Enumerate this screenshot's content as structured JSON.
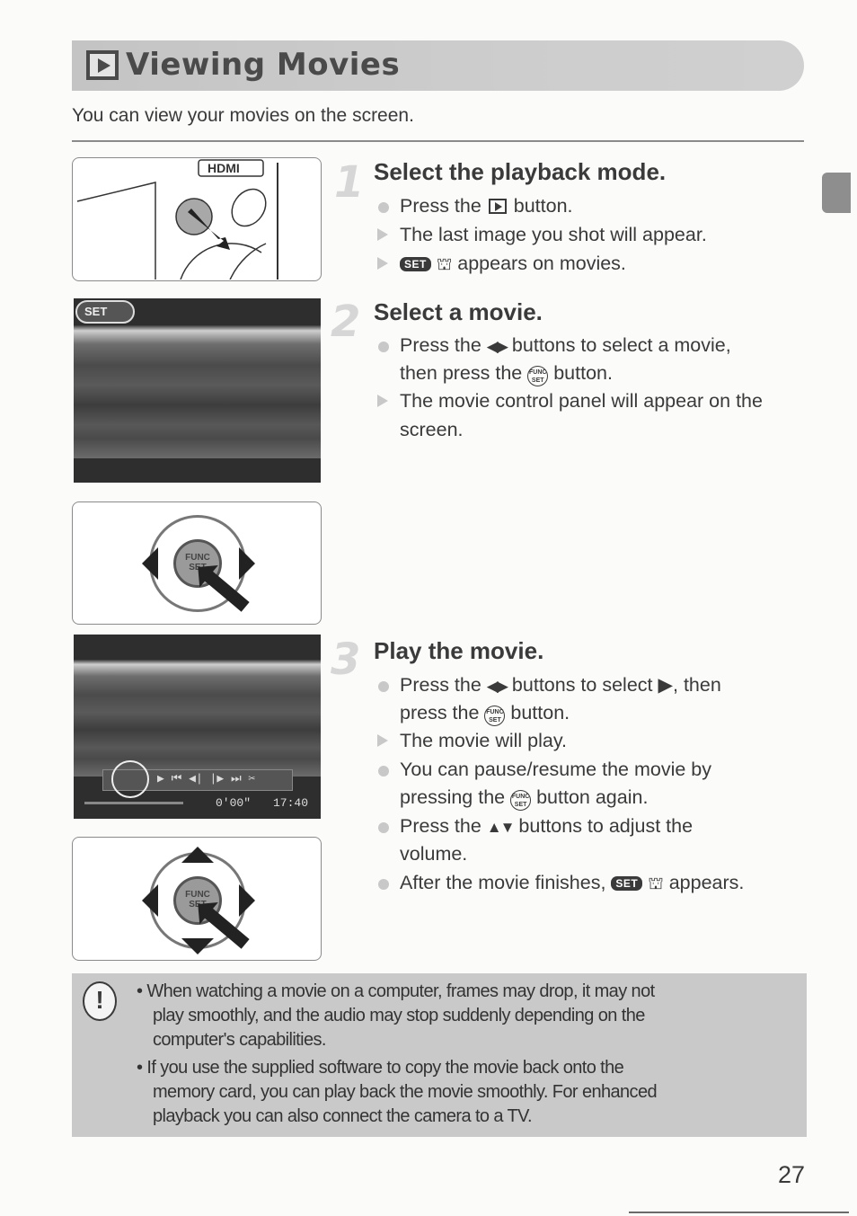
{
  "header": {
    "title": "Viewing Movies",
    "title_icon": "playback-icon",
    "intro": "You can view your movies on the screen."
  },
  "steps": [
    {
      "number": "1",
      "title": "Select the playback mode.",
      "lines": [
        {
          "type": "action",
          "pre": "Press the ",
          "icon": "playback-button-icon",
          "post": " button."
        },
        {
          "type": "result",
          "text": "The last image you shot will appear."
        },
        {
          "type": "result",
          "badge": "SET",
          "icon": "movie-icon",
          "post": " appears on movies."
        }
      ]
    },
    {
      "number": "2",
      "title": "Select a movie.",
      "lines": [
        {
          "type": "action",
          "pre": "Press the ",
          "arrows": "◀▶",
          "post": " buttons to select a movie,"
        },
        {
          "type": "cont",
          "pre": "then press the ",
          "icon": "func-set-icon",
          "post": " button."
        },
        {
          "type": "result",
          "text": "The movie control panel will appear on the"
        },
        {
          "type": "cont",
          "text": "screen."
        }
      ]
    },
    {
      "number": "3",
      "title": "Play the movie.",
      "lines": [
        {
          "type": "action",
          "pre": "Press the ",
          "arrows": "◀▶",
          "mid": " buttons to select ",
          "play": "▶",
          "post": ", then"
        },
        {
          "type": "cont",
          "pre": "press the ",
          "icon": "func-set-icon",
          "post": " button."
        },
        {
          "type": "result",
          "text": "The movie will play."
        },
        {
          "type": "action",
          "text": "You can pause/resume the movie by"
        },
        {
          "type": "cont",
          "pre": "pressing the ",
          "icon": "func-set-icon",
          "post": " button again."
        },
        {
          "type": "action",
          "pre": "Press the ",
          "arrows": "▲▼",
          "post": " buttons to adjust the"
        },
        {
          "type": "cont",
          "text": "volume."
        },
        {
          "type": "action",
          "pre": "After the movie finishes, ",
          "badge": "SET",
          "icon": "movie-icon",
          "post": " appears."
        }
      ]
    }
  ],
  "icons": {
    "func_top": "FUNC",
    "func_bottom": "SET",
    "set_badge": "SET",
    "movie_glyph": "🎥"
  },
  "illustrations": {
    "camera_label": "HDMI",
    "dpad_center": "FUNC SET",
    "screen_badge": "SET",
    "movie_time": "0'00\"",
    "clock_time": "17:40"
  },
  "caution": {
    "icon": "!",
    "items": [
      [
        "• When watching a movie on a computer, frames may drop, it may not",
        "play smoothly, and the audio may stop suddenly depending on the",
        "computer's capabilities."
      ],
      [
        "• If you use the supplied software to copy the movie back onto the",
        "memory card, you can play back the movie smoothly. For enhanced",
        "playback you can also connect the camera to a TV."
      ]
    ]
  },
  "footer": {
    "page_number": "27"
  }
}
